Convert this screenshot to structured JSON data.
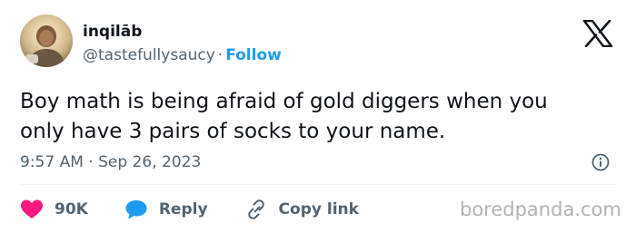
{
  "author": {
    "display_name": "inqilāb",
    "handle": "@tastefullysaucy",
    "separator": "·",
    "follow_label": "Follow"
  },
  "tweet": {
    "text_line_1": "Boy math is being afraid of gold diggers when you",
    "text_line_2": "only have 3 pairs of socks to your name.",
    "time": "9:57 AM",
    "separator": "·",
    "date": "Sep 26, 2023"
  },
  "actions": {
    "like_count": "90K",
    "reply_label": "Reply",
    "copy_link_label": "Copy link"
  },
  "icons": {
    "platform_logo": "x-logo-icon",
    "info": "info-icon",
    "like": "heart-icon",
    "reply": "speech-bubble-icon",
    "copy_link": "link-icon"
  },
  "colors": {
    "text": "#0f1419",
    "secondary_text": "#536471",
    "follow_blue": "#1d9bf0",
    "heart": "#f91880",
    "reply_bubble": "#1d9bf0",
    "watermark": "#b3b3b3"
  },
  "watermark": "boredpanda.com"
}
